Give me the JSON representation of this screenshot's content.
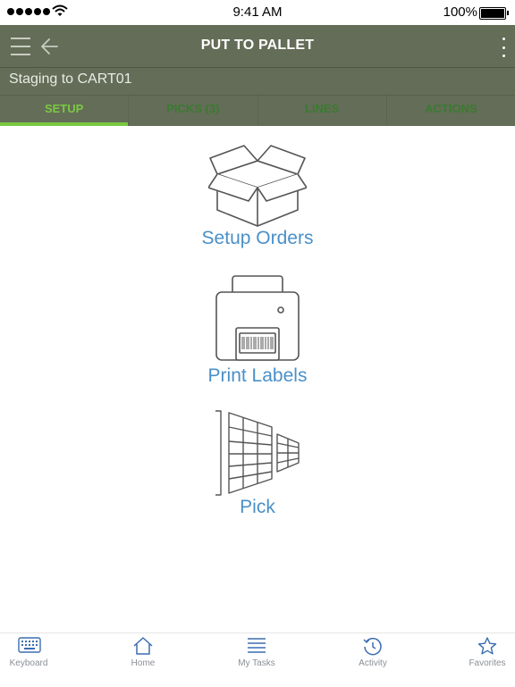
{
  "status_bar": {
    "time": "9:41 AM",
    "battery": "100%"
  },
  "header": {
    "title": "PUT TO PALLET",
    "subtitle": "Staging to CART01"
  },
  "tabs": [
    {
      "label": "SETUP",
      "active": true
    },
    {
      "label": "PICKS (3)",
      "active": false
    },
    {
      "label": "LINES",
      "active": false
    },
    {
      "label": "ACTIONS",
      "active": false
    }
  ],
  "actions": {
    "setup_orders": "Setup Orders",
    "print_labels": "Print Labels",
    "pick": "Pick"
  },
  "bottom_nav": [
    {
      "label": "Keyboard",
      "icon": "keyboard-icon"
    },
    {
      "label": "Home",
      "icon": "home-icon"
    },
    {
      "label": "My Tasks",
      "icon": "list-icon"
    },
    {
      "label": "Activity",
      "icon": "history-icon"
    },
    {
      "label": "Favorites",
      "icon": "star-icon"
    }
  ],
  "colors": {
    "header_bg": "#646d57",
    "tab_active": "#7ac943",
    "tab_inactive": "#3a7a31",
    "link_blue": "#4a90c8",
    "nav_blue": "#3b6db0"
  }
}
